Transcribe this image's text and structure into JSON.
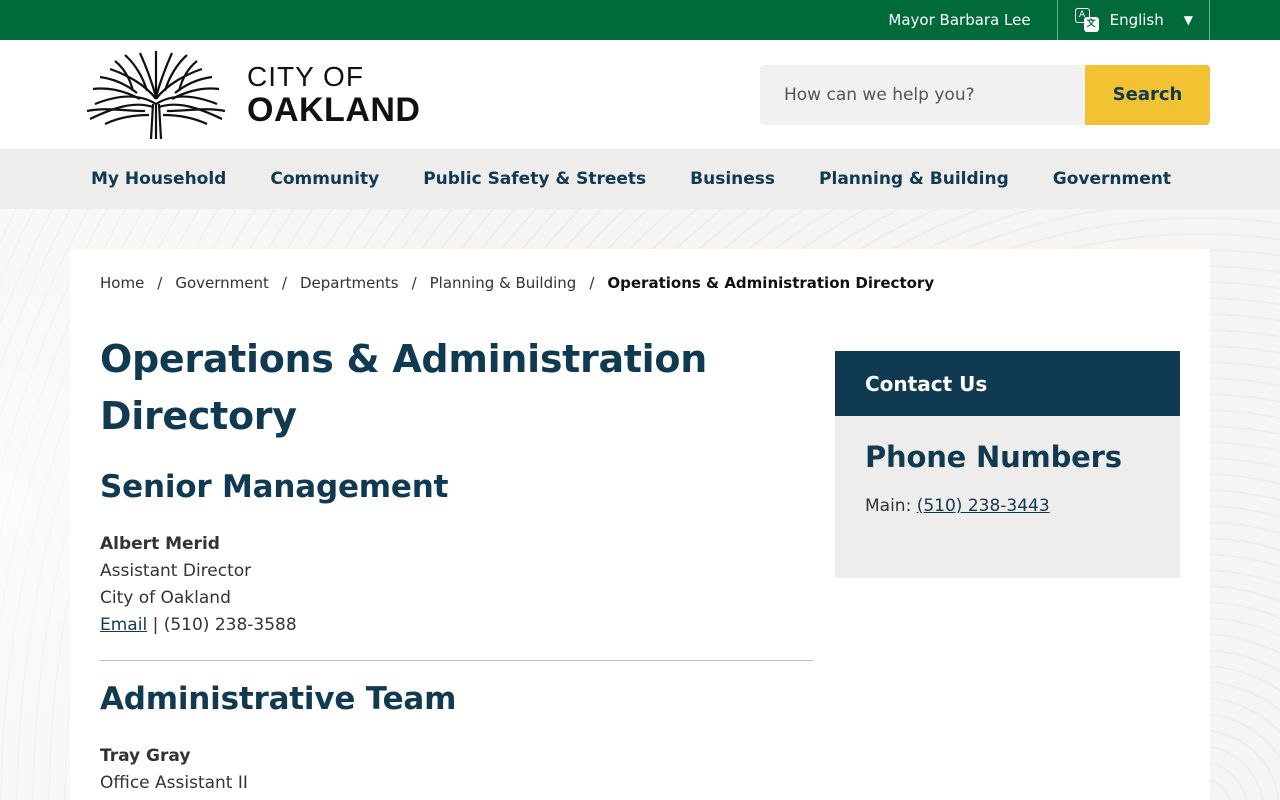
{
  "topbar": {
    "mayor_link": "Mayor Barbara Lee",
    "language": "English",
    "caret": "▼"
  },
  "header": {
    "logo_line1": "CITY OF",
    "logo_line2": "OAKLAND",
    "search_placeholder": "How can we help you?",
    "search_button": "Search"
  },
  "nav": {
    "items": [
      "My Household",
      "Community",
      "Public Safety & Streets",
      "Business",
      "Planning & Building",
      "Government"
    ]
  },
  "breadcrumb": {
    "items": [
      "Home",
      "Government",
      "Departments",
      "Planning & Building"
    ],
    "current": "Operations & Administration Directory",
    "separator": "/"
  },
  "main": {
    "title_line1": "Operations & Administration",
    "title_line2": "Directory",
    "sections": [
      {
        "heading": "Senior Management",
        "person": {
          "name": "Albert Merid",
          "role": "Assistant Director",
          "org": "City of Oakland",
          "email_label": "Email",
          "phone": " | (510) 238-3588"
        }
      },
      {
        "heading": "Administrative Team",
        "person": {
          "name": "Tray Gray",
          "role": "Office Assistant II"
        }
      }
    ]
  },
  "sidebar": {
    "contact_heading": "Contact Us",
    "phone_heading": "Phone Numbers",
    "main_label": "Main: ",
    "main_phone": "(510) 238-3443"
  },
  "colors": {
    "green": "#006a3b",
    "navy": "#0f3a52",
    "yellow": "#f1c232"
  }
}
